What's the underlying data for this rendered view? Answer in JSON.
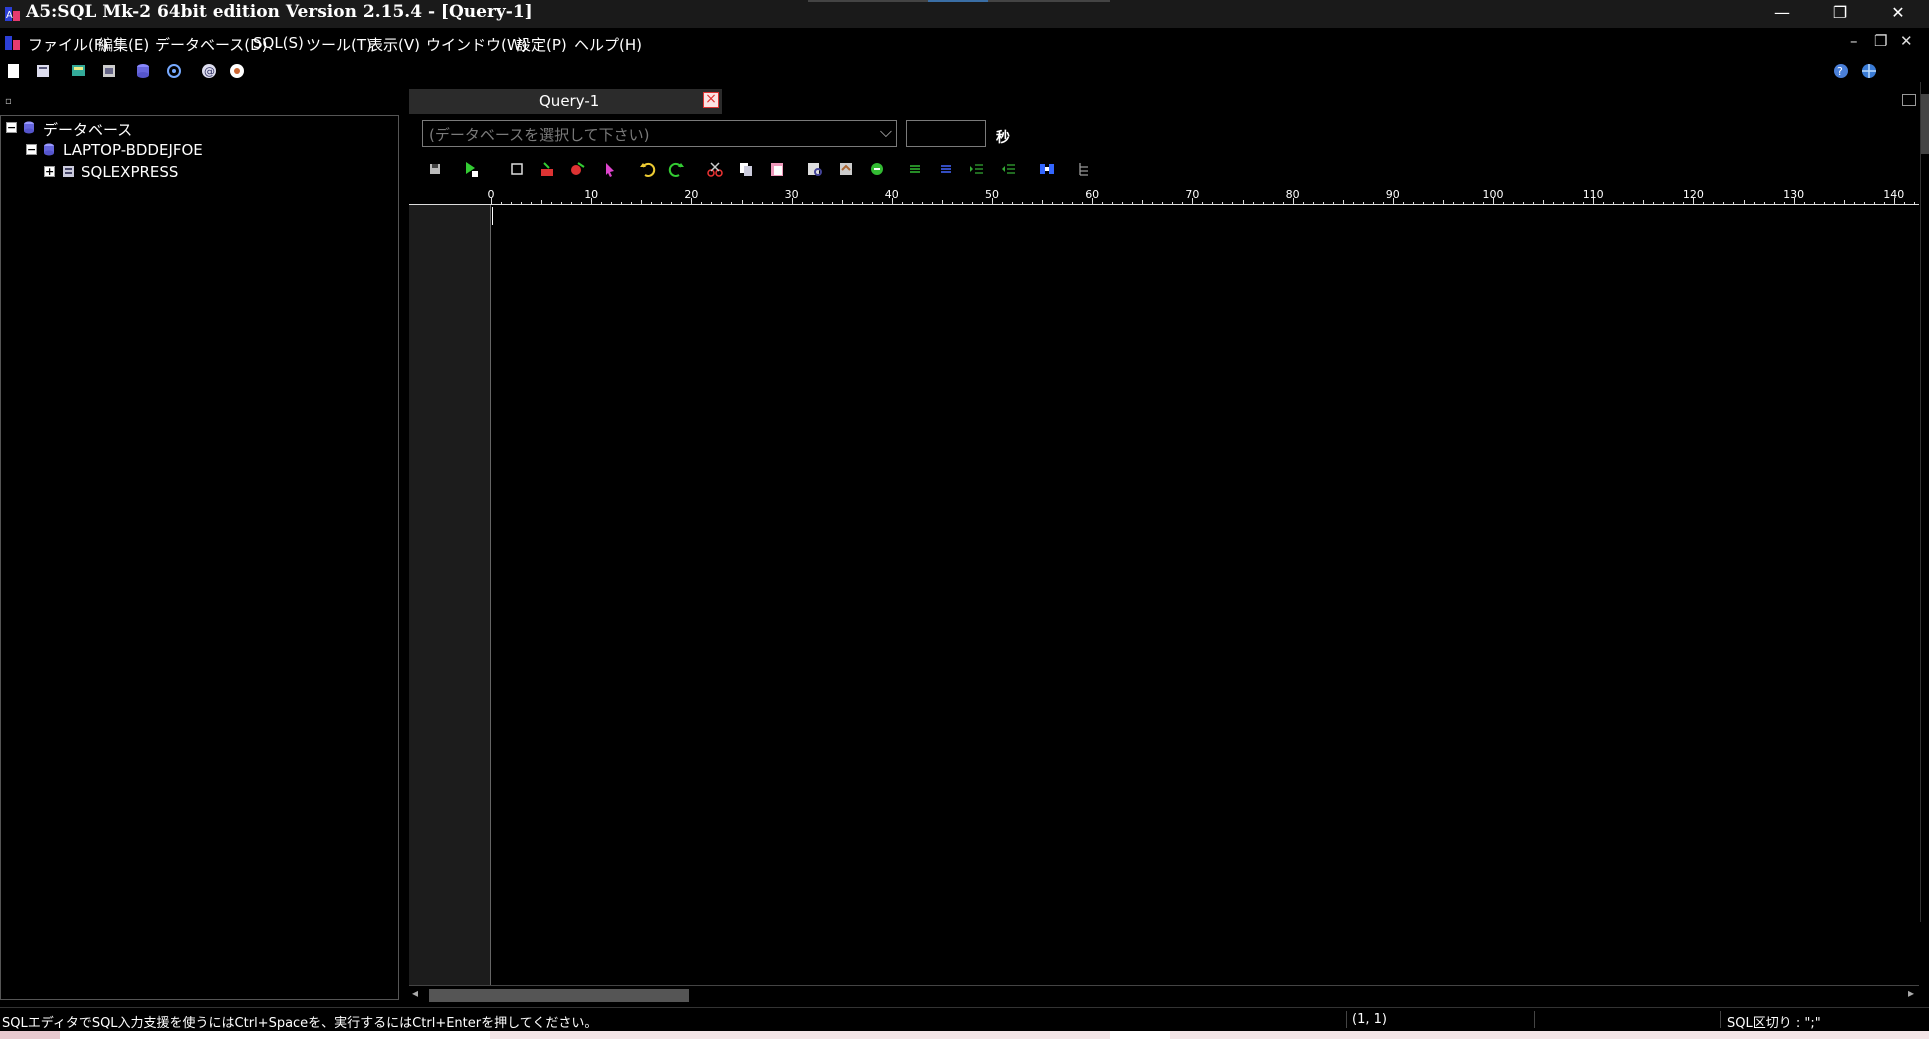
{
  "window": {
    "title": "A5:SQL Mk-2 64bit edition Version 2.15.4 - [Query-1]",
    "min_icon": "—",
    "restore_icon": "❐",
    "close_icon": "✕"
  },
  "menu": [
    "ファイル(F)",
    "編集(E)",
    "データベース(D)",
    "SQL(S)",
    "ツール(T)",
    "表示(V)",
    "ウインドウ(W)",
    "設定(P)",
    "ヘルプ(H)"
  ],
  "mdi_controls": {
    "min": "–",
    "restore": "❐",
    "close": "✕"
  },
  "tree": {
    "root": "データベース",
    "server": "LAPTOP-BDDEJFOE",
    "instance": "SQLEXPRESS",
    "expanded_glyph": "−",
    "collapsed_glyph": "+"
  },
  "tab": {
    "label": "Query-1",
    "close_glyph": "×"
  },
  "query": {
    "db_placeholder": "(データベースを選択して下さい)",
    "db_arrow": "⌵",
    "timeout_value": "",
    "timeout_unit": "秒"
  },
  "ruler": {
    "labels": [
      "0",
      "10",
      "20",
      "30",
      "40",
      "50",
      "60",
      "70",
      "80",
      "90",
      "100",
      "110",
      "120",
      "130",
      "140"
    ]
  },
  "scroll": {
    "left": "◂",
    "right": "▸"
  },
  "status": {
    "hint": "SQLエディタでSQL入力支援を使うにはCtrl+Spaceを、実行するにはCtrl+Enterを押してください。",
    "cursor": "(1, 1)",
    "delimiter": "SQL区切り : \";\""
  },
  "colors": {
    "accent": "#3a6ea5",
    "background": "#000000",
    "titlebar": "#1a1a1a"
  }
}
